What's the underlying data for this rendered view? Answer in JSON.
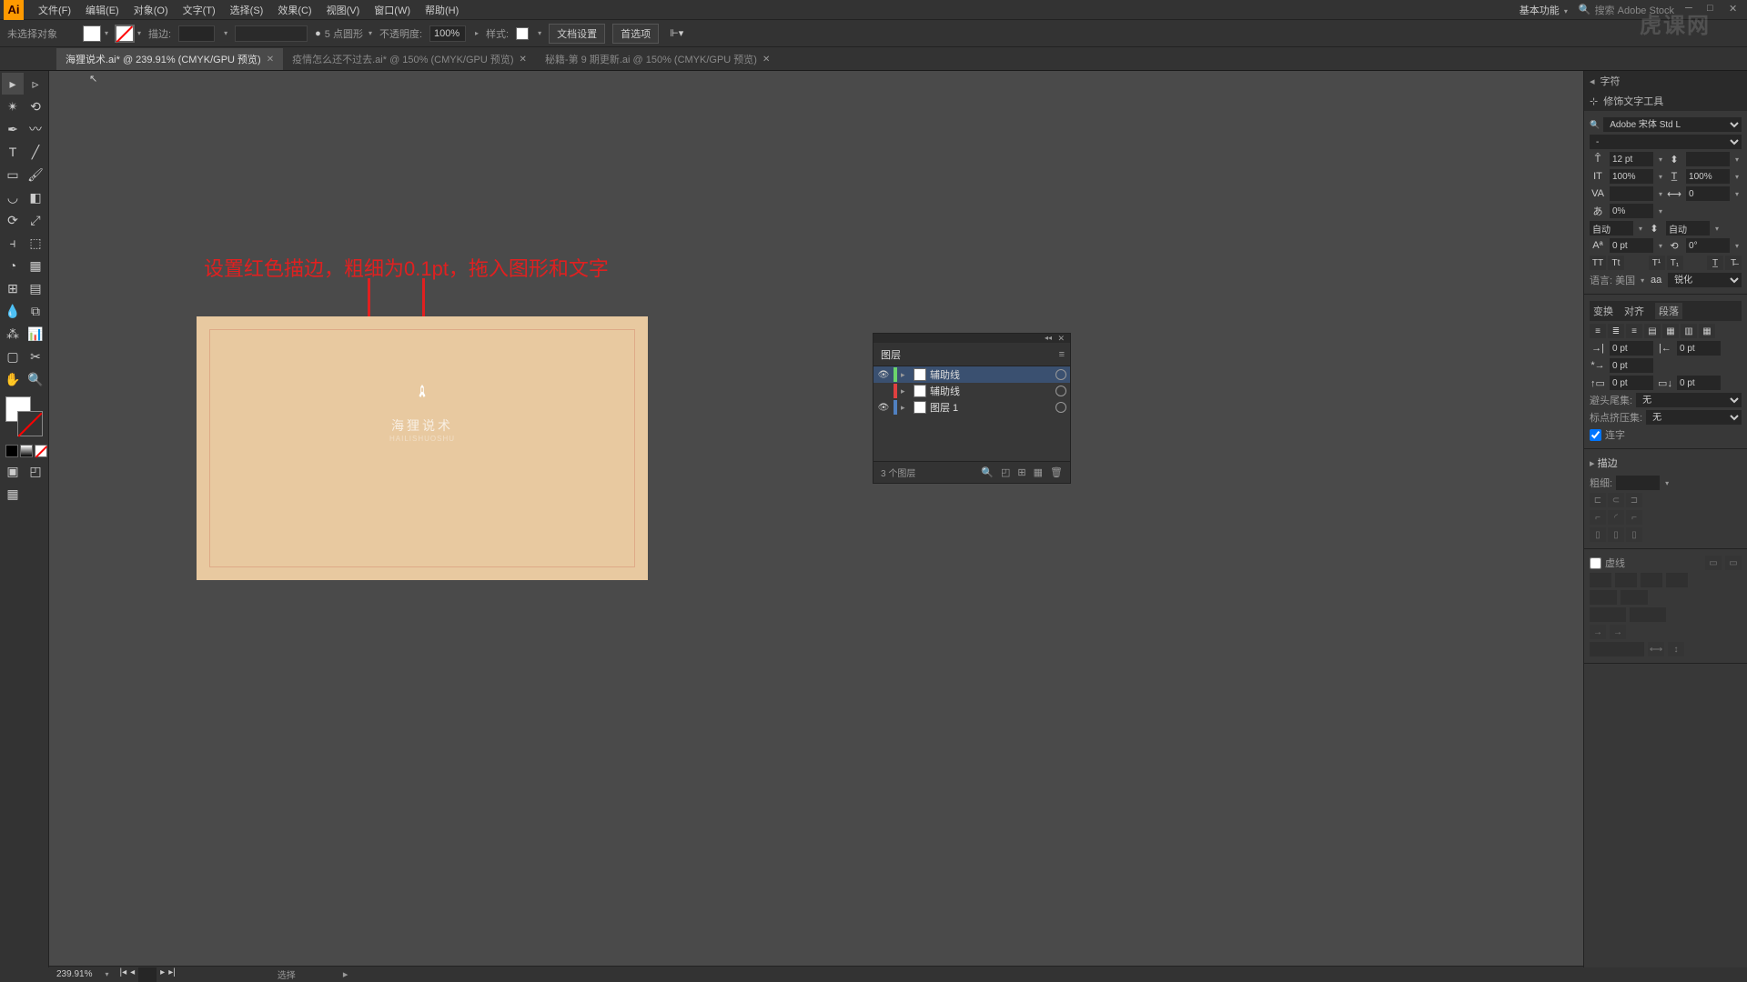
{
  "menubar": {
    "items": [
      "文件(F)",
      "编辑(E)",
      "对象(O)",
      "文字(T)",
      "选择(S)",
      "效果(C)",
      "视图(V)",
      "窗口(W)",
      "帮助(H)"
    ],
    "workspace": "基本功能",
    "search_placeholder": "搜索 Adobe Stock"
  },
  "controlbar": {
    "selection_label": "未选择对象",
    "stroke_label": "描边:",
    "stroke_weight": "",
    "brush_label": "5 点圆形",
    "opacity_label": "不透明度:",
    "opacity_value": "100%",
    "style_label": "样式:",
    "doc_setup": "文档设置",
    "prefs": "首选项"
  },
  "tabs": [
    {
      "label": "海狸说术.ai* @ 239.91% (CMYK/GPU 预览)",
      "active": true
    },
    {
      "label": "疫情怎么还不过去.ai* @ 150% (CMYK/GPU 预览)",
      "active": false
    },
    {
      "label": "秘籍-第 9 期更新.ai @ 150% (CMYK/GPU 预览)",
      "active": false
    }
  ],
  "annotation": {
    "text": "设置红色描边，粗细为0.1pt，拖入图形和文字"
  },
  "artboard": {
    "logo_text": "海狸说术",
    "logo_sub": "HAILISHUOSHU"
  },
  "layers": {
    "title": "图层",
    "items": [
      {
        "name": "辅助线",
        "visible": true,
        "color": "#6bd46b",
        "selected": true
      },
      {
        "name": "辅助线",
        "visible": false,
        "color": "#e04040",
        "selected": false
      },
      {
        "name": "图层 1",
        "visible": true,
        "color": "#5080c0",
        "selected": false
      }
    ],
    "footer": "3 个图层"
  },
  "char_panel": {
    "title": "修饰文字工具",
    "char_label": "字符",
    "font": "Adobe 宋体 Std L",
    "font_style": "-",
    "size": "12 pt",
    "leading": "自动",
    "vscale": "100%",
    "hscale": "100%",
    "kerning": "0",
    "tracking": "0%",
    "baseline": "自动",
    "baseline2": "自动",
    "shift": "0 pt",
    "rotation": "0°",
    "lang": "语言: 美国",
    "antialiasing": "锐化"
  },
  "para_panel": {
    "tabs": [
      "变换",
      "对齐",
      "段落"
    ],
    "indent_left": "0 pt",
    "indent_right": "0 pt",
    "indent_first": "0 pt",
    "space_before": "0 pt",
    "space_after": "0 pt",
    "hyphen_label": "避头尾集:",
    "hyphen_val": "无",
    "kinsoku_label": "标点挤压集:",
    "kinsoku_val": "无",
    "hyphenate": "连字"
  },
  "stroke_panel": {
    "title": "描边",
    "weight_label": "粗细:",
    "weight_val": ""
  },
  "dash_panel": {
    "title": "虚线"
  },
  "statusbar": {
    "zoom": "239.91%",
    "mode": "选择"
  },
  "watermark": "虎课网"
}
